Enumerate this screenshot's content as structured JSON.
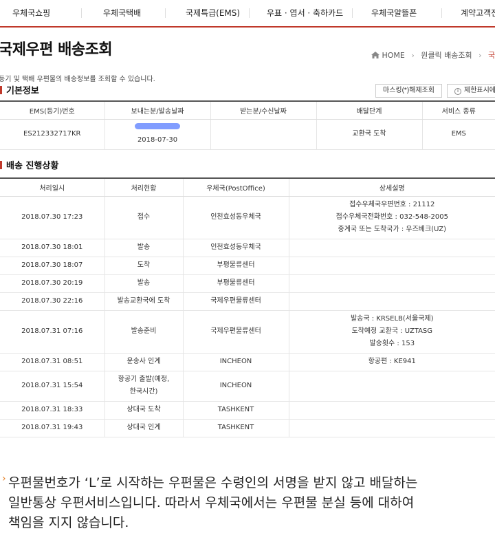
{
  "nav": {
    "items": [
      "우체국쇼핑",
      "우체국택배",
      "국제특급(EMS)",
      "우표 · 엽서 · 축하카드",
      "우체국알뜰폰",
      "계약고객전"
    ]
  },
  "header": {
    "title": "국제우편 배송조회",
    "breadcrumb": {
      "home": "HOME",
      "b1": "원클릭 배송조회",
      "current": "국제우"
    }
  },
  "description": "등기 및 택배 우편물의 배송정보를 조회할 수 있습니다.",
  "basic": {
    "heading": "기본정보",
    "mask_button": "마스킹(*)해제조회",
    "display_button": "제한표시에",
    "columns": [
      "EMS(등기)번호",
      "보내는분/발송날짜",
      "받는분/수신날짜",
      "배달단계",
      "서비스 종류"
    ],
    "row": {
      "tracking_no": "ES212332717KR",
      "send_date": "2018-07-30",
      "recv": "",
      "stage": "교환국 도착",
      "service": "EMS"
    }
  },
  "progress": {
    "heading": "배송 진행상황",
    "columns": [
      "처리일시",
      "처리현황",
      "우체국(PostOffice)",
      "상세설명"
    ],
    "rows": [
      {
        "time": "2018.07.30 17:23",
        "status": "접수",
        "office": "인천효성동우체국",
        "detail": [
          "접수우체국우편번호 : 21112",
          "접수우체국전화번호 : 032-548-2005",
          "중계국 또는 도착국가 : 우즈베크(UZ)"
        ]
      },
      {
        "time": "2018.07.30 18:01",
        "status": "발송",
        "office": "인천효성동우체국",
        "detail": []
      },
      {
        "time": "2018.07.30 18:07",
        "status": "도착",
        "office": "부평물류센터",
        "detail": []
      },
      {
        "time": "2018.07.30 20:19",
        "status": "발송",
        "office": "부평물류센터",
        "detail": []
      },
      {
        "time": "2018.07.30 22:16",
        "status": "발송교환국에 도착",
        "office": "국제우편물류센터",
        "detail": []
      },
      {
        "time": "2018.07.31 07:16",
        "status": "발송준비",
        "office": "국제우편물류센터",
        "detail": [
          "발송국 : KRSELB(서울국제)",
          "도착예정 교환국 : UZTASG",
          "발송횟수 : 153"
        ]
      },
      {
        "time": "2018.07.31 08:51",
        "status": "운송사 인계",
        "office": "INCHEON",
        "detail": [
          "항공편 : KE941"
        ]
      },
      {
        "time": "2018.07.31 15:54",
        "status": "항공기 출발(예정,\n한국시간)",
        "office": "INCHEON",
        "detail": []
      },
      {
        "time": "2018.07.31 18:33",
        "status": "상대국 도착",
        "office": "TASHKENT",
        "detail": []
      },
      {
        "time": "2018.07.31 19:43",
        "status": "상대국 인계",
        "office": "TASHKENT",
        "detail": []
      }
    ]
  },
  "footnote": {
    "mark": "›",
    "lines": [
      "우편물번호가 ‘L’로 시작하는 우편물은 수령인의 서명을 받지 않고 배달하는",
      "일반통상 우편서비스입니다. 따라서 우체국에서는 우편물 분실 등에 대하여",
      "책임을 지지 않습니다."
    ]
  },
  "colors": {
    "accent": "#c0392b",
    "scribble": "#6b8cff"
  }
}
